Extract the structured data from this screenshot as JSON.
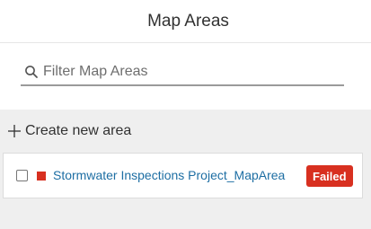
{
  "header": {
    "title": "Map Areas"
  },
  "search": {
    "placeholder": "Filter Map Areas",
    "value": "",
    "icon": "search-icon"
  },
  "actions": {
    "create_label": "Create new area",
    "create_icon": "plus-icon"
  },
  "map_areas": [
    {
      "name": "Stormwater Inspections Project_MapArea",
      "status": "Failed",
      "checked": false,
      "status_color": "#d83020",
      "name_color": "#1d6ea3"
    }
  ]
}
